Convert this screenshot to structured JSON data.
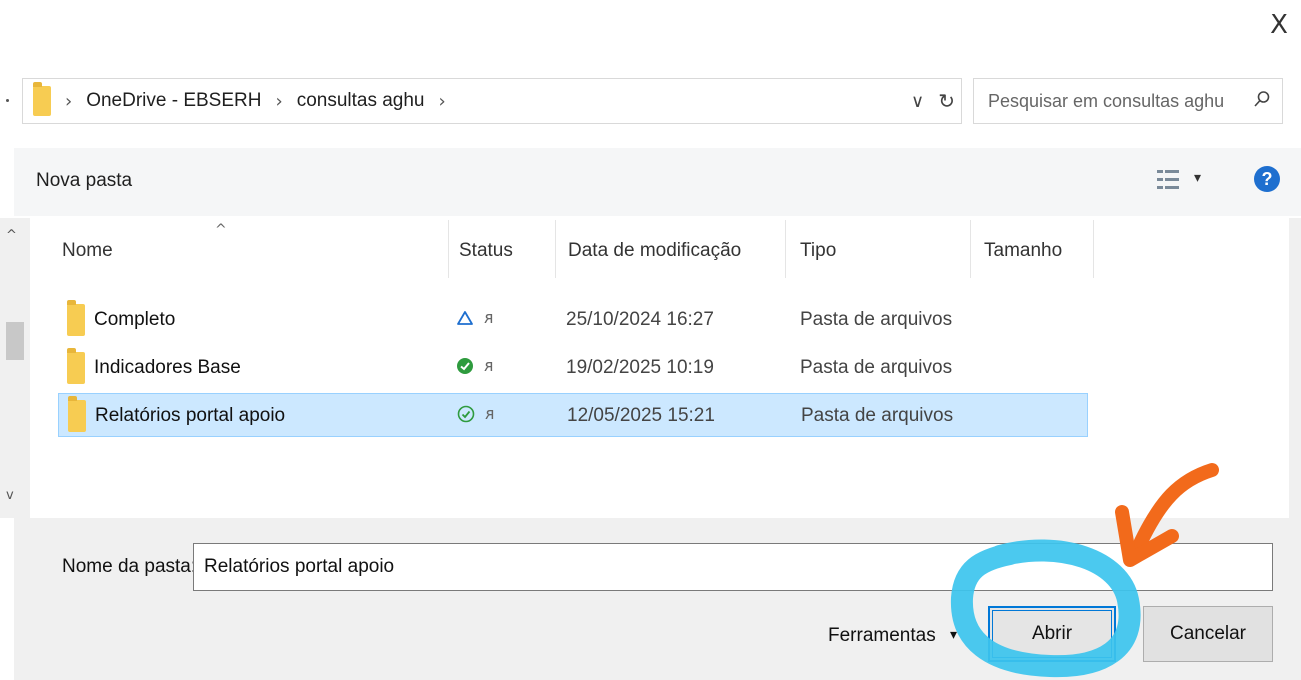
{
  "dialog": {
    "close_glyph": "X"
  },
  "address_bar": {
    "crumbs": [
      "OneDrive - EBSERH",
      "consultas aghu"
    ],
    "separator": "›",
    "dropdown_glyph": "∨",
    "refresh_glyph": "↻"
  },
  "search": {
    "placeholder": "Pesquisar em consultas aghu",
    "icon_glyph": "⚲"
  },
  "toolbar": {
    "new_folder_label": "Nova pasta",
    "view_arrow": "▾",
    "help_glyph": "?"
  },
  "columns": {
    "name": "Nome",
    "status": "Status",
    "modified": "Data de modificação",
    "type": "Tipo",
    "size": "Tamanho",
    "sort_glyph": "^"
  },
  "scroll": {
    "up_glyph": "^",
    "down_glyph": "v"
  },
  "files": [
    {
      "name": "Completo",
      "status": "cloud",
      "modified": "25/10/2024 16:27",
      "type": "Pasta de arquivos",
      "selected": false
    },
    {
      "name": "Indicadores Base",
      "status": "synced-filled",
      "modified": "19/02/2025 10:19",
      "type": "Pasta de arquivos",
      "selected": false
    },
    {
      "name": "Relatórios portal apoio",
      "status": "synced-outline",
      "modified": "12/05/2025 15:21",
      "type": "Pasta de arquivos",
      "selected": true
    }
  ],
  "person_glyph": "ᴙ",
  "footer": {
    "folder_name_label": "Nome da pasta:",
    "folder_name_value": "Relatórios portal apoio",
    "tools_label": "Ferramentas",
    "tools_arrow": "▾",
    "open_label": "Abrir",
    "cancel_label": "Cancelar"
  },
  "colors": {
    "selection": "#cce8ff",
    "accent": "#0078d7",
    "annotation_circle": "#3cc4ee",
    "annotation_arrow": "#f26a1b",
    "synced_green": "#2e9b3e",
    "cloud_blue": "#1e6fcf"
  }
}
